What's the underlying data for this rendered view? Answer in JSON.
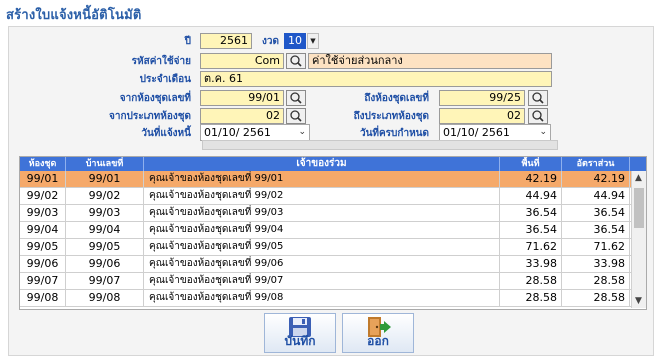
{
  "window": {
    "title": "สร้างใบแจ้งหนี้อัติโนมัติ"
  },
  "form": {
    "year_label": "ปี",
    "year_value": "2561",
    "period_label": "งวด",
    "period_value": "10",
    "expense_code_label": "รหัสค่าใช้จ่าย",
    "expense_code_value": "Com",
    "expense_name_value": "ค่าใช้จ่ายส่วนกลาง",
    "month_label": "ประจำเดือน",
    "month_value": "ต.ค. 61",
    "from_room_label": "จากห้องชุดเลขที่",
    "from_room_value": "99/01",
    "to_room_label": "ถึงห้องชุดเลขที่",
    "to_room_value": "99/25",
    "from_type_label": "จากประเภทห้องชุด",
    "from_type_value": "02",
    "to_type_label": "ถึงประเภทห้องชุด",
    "to_type_value": "02",
    "notify_date_label": "วันที่แจ้งหนี้",
    "notify_date_value": "01/10/  2561",
    "due_date_label": "วันที่ครบกำหนด",
    "due_date_value": "01/10/  2561",
    "progress": 0
  },
  "grid": {
    "columns": [
      "ห้องชุด",
      "บ้านเลขที่",
      "เจ้าของร่วม",
      "พื้นที่",
      "อัตราส่วน"
    ],
    "rows": [
      [
        "99/01",
        "99/01",
        "คุณเจ้าของห้องชุดเลขที่ 99/01",
        "42.19",
        "42.19"
      ],
      [
        "99/02",
        "99/02",
        "คุณเจ้าของห้องชุดเลขที่ 99/02",
        "44.94",
        "44.94"
      ],
      [
        "99/03",
        "99/03",
        "คุณเจ้าของห้องชุดเลขที่ 99/03",
        "36.54",
        "36.54"
      ],
      [
        "99/04",
        "99/04",
        "คุณเจ้าของห้องชุดเลขที่ 99/04",
        "36.54",
        "36.54"
      ],
      [
        "99/05",
        "99/05",
        "คุณเจ้าของห้องชุดเลขที่ 99/05",
        "71.62",
        "71.62"
      ],
      [
        "99/06",
        "99/06",
        "คุณเจ้าของห้องชุดเลขที่ 99/06",
        "33.98",
        "33.98"
      ],
      [
        "99/07",
        "99/07",
        "คุณเจ้าของห้องชุดเลขที่ 99/07",
        "28.58",
        "28.58"
      ],
      [
        "99/08",
        "99/08",
        "คุณเจ้าของห้องชุดเลขที่ 99/08",
        "28.58",
        "28.58"
      ]
    ],
    "selected_row": 0
  },
  "buttons": {
    "save_label": "บันทึก",
    "exit_label": "ออก"
  },
  "colors": {
    "accent": "#1f4fa5",
    "field": "#fff5b8",
    "selected_row": "#f5a96a",
    "header": "#3f73d8"
  },
  "icons": {
    "search": "magnifier-icon",
    "save": "floppy-disk-icon",
    "exit": "exit-door-icon",
    "dropdown": "chevron-down-icon"
  }
}
